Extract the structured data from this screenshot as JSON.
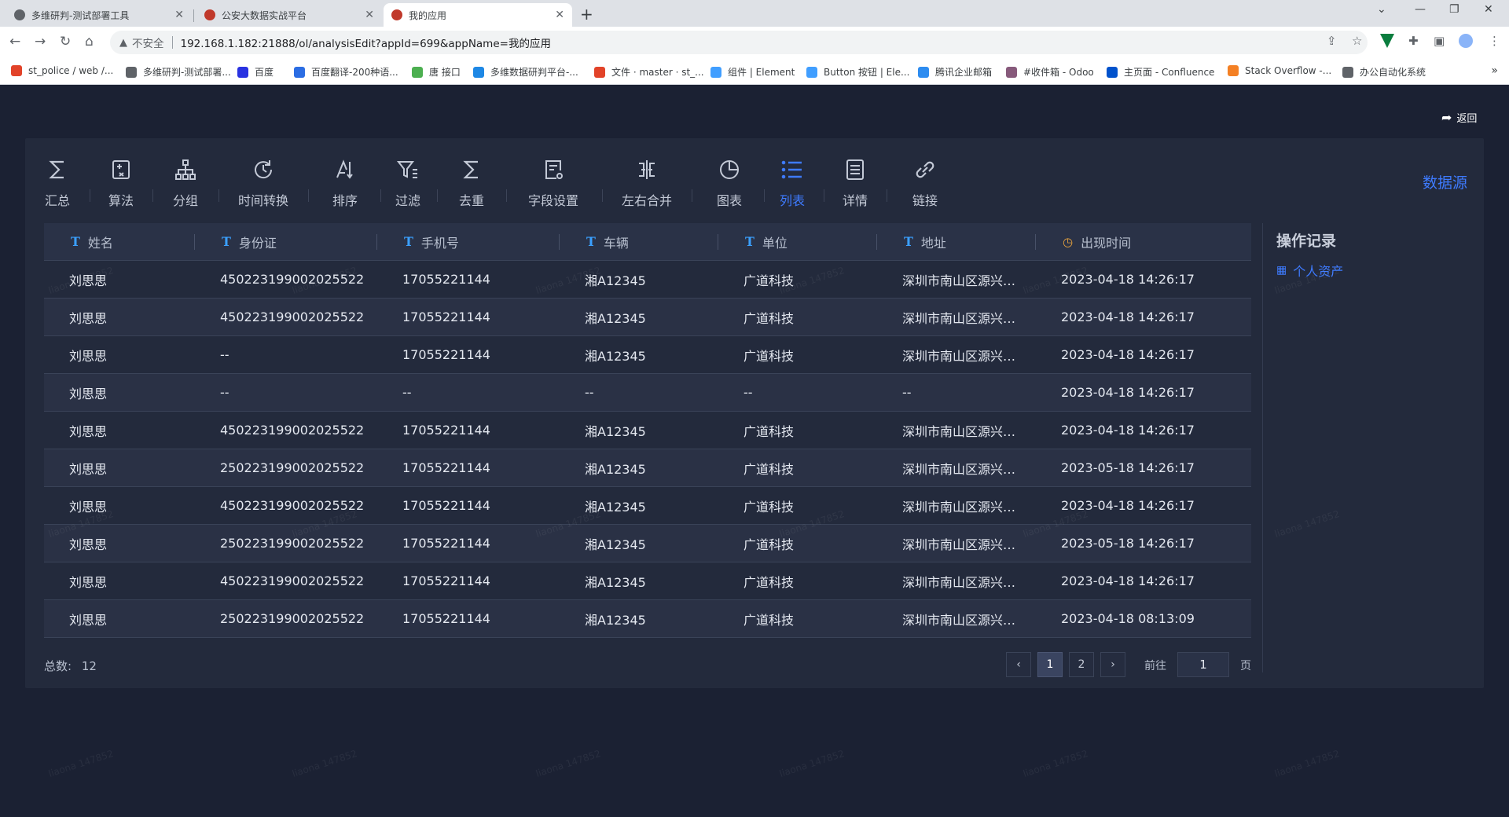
{
  "browser": {
    "tabs": [
      {
        "title": "多维研判-测试部署工具",
        "fav_color": "#5f6368"
      },
      {
        "title": "公安大数据实战平台",
        "fav_color": "#c0392b"
      },
      {
        "title": "我的应用",
        "fav_color": "#c0392b"
      }
    ],
    "new_tab": "+",
    "url_warning": "不安全",
    "url": "192.168.1.182:21888/ol/analysisEdit?appId=699&appName=我的应用",
    "bookmarks": [
      {
        "label": "st_police / web /...",
        "color": "#e24329"
      },
      {
        "label": "多维研判-测试部署...",
        "color": "#5f6368"
      },
      {
        "label": "百度",
        "color": "#2932e1"
      },
      {
        "label": "百度翻译-200种语...",
        "color": "#2b6de3"
      },
      {
        "label": "唐 接口",
        "color": "#4caf50"
      },
      {
        "label": "多维数据研判平台-...",
        "color": "#1e88e5"
      },
      {
        "label": "文件 · master · st_...",
        "color": "#e24329"
      },
      {
        "label": "组件 | Element",
        "color": "#409eff"
      },
      {
        "label": "Button 按钮 | Ele...",
        "color": "#409eff"
      },
      {
        "label": "腾讯企业邮箱",
        "color": "#2d8cf0"
      },
      {
        "label": "#收件箱 - Odoo",
        "color": "#875a7b"
      },
      {
        "label": "主页面 - Confluence",
        "color": "#0052cc"
      },
      {
        "label": "Stack Overflow -...",
        "color": "#f48024"
      },
      {
        "label": "办公自动化系统",
        "color": "#5f6368"
      }
    ],
    "more": "»"
  },
  "app": {
    "back_label": "返回",
    "datasource_label": "数据源",
    "tools": [
      {
        "label": "汇总",
        "icon": "sigma-icon"
      },
      {
        "label": "算法",
        "icon": "calculator-icon"
      },
      {
        "label": "分组",
        "icon": "hierarchy-icon"
      },
      {
        "label": "时间转换",
        "icon": "time-convert-icon"
      },
      {
        "label": "排序",
        "icon": "sort-icon"
      },
      {
        "label": "过滤",
        "icon": "filter-icon"
      },
      {
        "label": "去重",
        "icon": "sigma-icon"
      },
      {
        "label": "字段设置",
        "icon": "field-settings-icon"
      },
      {
        "label": "左右合并",
        "icon": "merge-icon"
      },
      {
        "label": "图表",
        "icon": "pie-chart-icon"
      },
      {
        "label": "列表",
        "icon": "list-icon"
      },
      {
        "label": "详情",
        "icon": "detail-icon"
      },
      {
        "label": "链接",
        "icon": "link-icon"
      }
    ],
    "active_tool": "列表",
    "table": {
      "columns": [
        "姓名",
        "身份证",
        "手机号",
        "车辆",
        "单位",
        "地址",
        "出现时间"
      ],
      "rows": [
        [
          "刘思思",
          "450223199002025522",
          "17055221144",
          "湘A12345",
          "广道科技",
          "深圳市南山区源兴科...",
          "2023-04-18 14:26:17"
        ],
        [
          "刘思思",
          "450223199002025522",
          "17055221144",
          "湘A12345",
          "广道科技",
          "深圳市南山区源兴科...",
          "2023-04-18 14:26:17"
        ],
        [
          "刘思思",
          "--",
          "17055221144",
          "湘A12345",
          "广道科技",
          "深圳市南山区源兴科...",
          "2023-04-18 14:26:17"
        ],
        [
          "刘思思",
          "--",
          "--",
          "--",
          "--",
          "--",
          "2023-04-18 14:26:17"
        ],
        [
          "刘思思",
          "450223199002025522",
          "17055221144",
          "湘A12345",
          "广道科技",
          "深圳市南山区源兴科...",
          "2023-04-18 14:26:17"
        ],
        [
          "刘思思",
          "250223199002025522",
          "17055221144",
          "湘A12345",
          "广道科技",
          "深圳市南山区源兴科...",
          "2023-05-18 14:26:17"
        ],
        [
          "刘思思",
          "450223199002025522",
          "17055221144",
          "湘A12345",
          "广道科技",
          "深圳市南山区源兴科...",
          "2023-04-18 14:26:17"
        ],
        [
          "刘思思",
          "250223199002025522",
          "17055221144",
          "湘A12345",
          "广道科技",
          "深圳市南山区源兴科...",
          "2023-05-18 14:26:17"
        ],
        [
          "刘思思",
          "450223199002025522",
          "17055221144",
          "湘A12345",
          "广道科技",
          "深圳市南山区源兴科...",
          "2023-04-18 14:26:17"
        ],
        [
          "刘思思",
          "250223199002025522",
          "17055221144",
          "湘A12345",
          "广道科技",
          "深圳市南山区源兴科...",
          "2023-04-18 08:13:09"
        ]
      ]
    },
    "oplog": {
      "title": "操作记录",
      "items": [
        "个人资产"
      ]
    },
    "pagination": {
      "total_label": "总数:",
      "total": "12",
      "pages": [
        "1",
        "2"
      ],
      "current_page": "1",
      "goto_label": "前往",
      "goto_value": "1",
      "page_suffix": "页"
    },
    "watermark": "liaona 147852",
    "accent_color": "#3e7bff"
  }
}
